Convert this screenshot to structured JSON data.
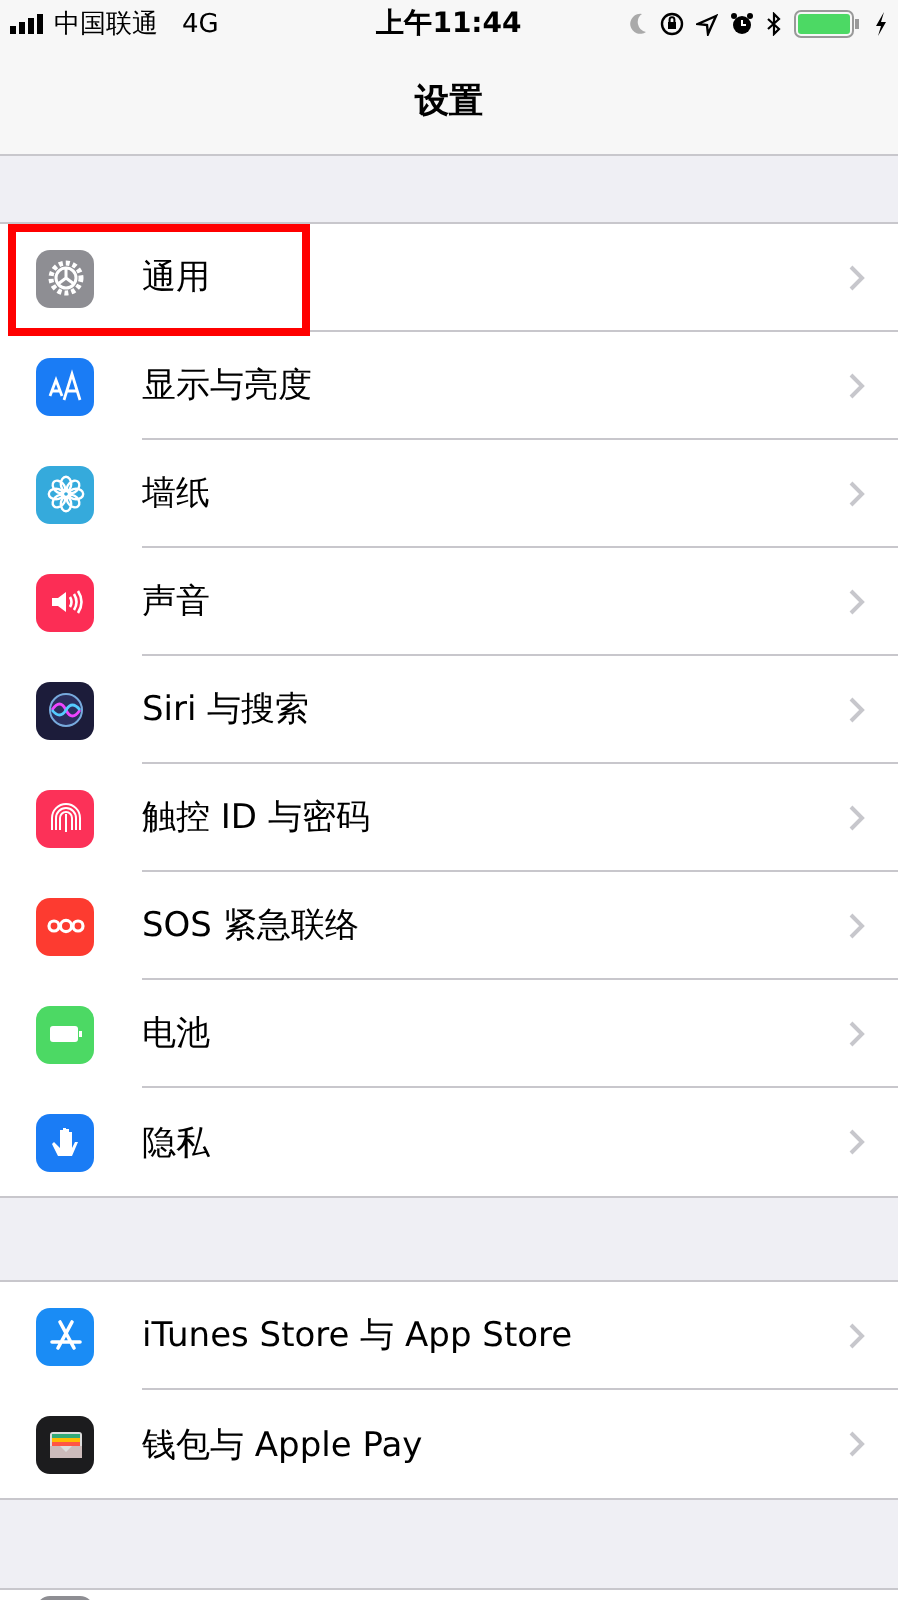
{
  "status_bar": {
    "carrier": "中国联通",
    "network": "4G",
    "time": "上午11:44"
  },
  "nav": {
    "title": "设置"
  },
  "groups": [
    {
      "items": [
        {
          "kind": "general",
          "label": "通用",
          "color": "#8e8e93",
          "highlighted": true
        },
        {
          "kind": "display",
          "label": "显示与亮度",
          "color": "#1a7cf5",
          "highlighted": false
        },
        {
          "kind": "wallpaper",
          "label": "墙纸",
          "color": "#35aadc",
          "highlighted": false
        },
        {
          "kind": "sound",
          "label": "声音",
          "color": "#fc2d55",
          "highlighted": false
        },
        {
          "kind": "siri",
          "label": "Siri 与搜索",
          "color": "#1c1c3a",
          "highlighted": false
        },
        {
          "kind": "touchid",
          "label": "触控 ID 与密码",
          "color": "#fc3158",
          "highlighted": false
        },
        {
          "kind": "sos",
          "label": "SOS 紧急联络",
          "color": "#fd3b30",
          "highlighted": false
        },
        {
          "kind": "battery",
          "label": "电池",
          "color": "#4cd964",
          "highlighted": false
        },
        {
          "kind": "privacy",
          "label": "隐私",
          "color": "#1a7cf5",
          "highlighted": false
        }
      ]
    },
    {
      "items": [
        {
          "kind": "appstore",
          "label": "iTunes Store 与 App Store",
          "color": "#1a8cf5",
          "highlighted": false
        },
        {
          "kind": "wallet",
          "label": "钱包与 Apple Pay",
          "color": "#1c1c1e",
          "highlighted": false
        }
      ]
    }
  ],
  "partial_row": {
    "color": "#8e8e93"
  }
}
